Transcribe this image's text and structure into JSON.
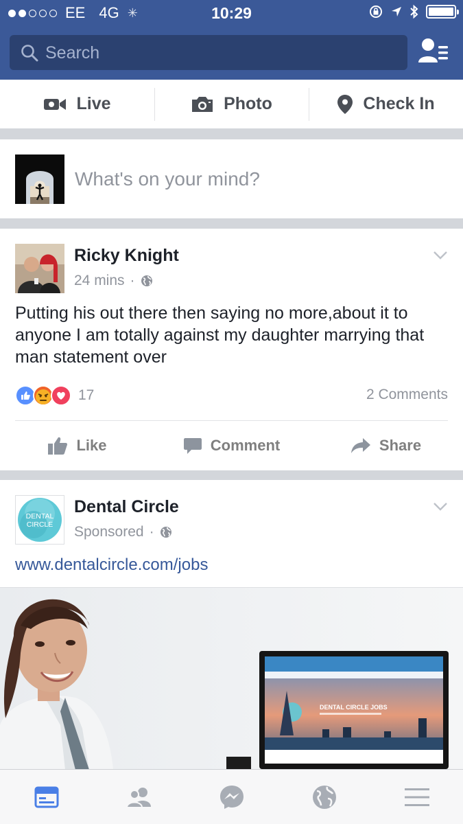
{
  "status_bar": {
    "carrier": "EE",
    "network": "4G",
    "time": "10:29"
  },
  "search": {
    "placeholder": "Search"
  },
  "composer": {
    "live_label": "Live",
    "photo_label": "Photo",
    "checkin_label": "Check In",
    "prompt": "What's on your mind?"
  },
  "post": {
    "author": "Ricky Knight",
    "time": "24 mins",
    "text": "Putting his out there then saying no more,about it to anyone I am totally against my daughter marrying that man statement over",
    "reaction_count": "17",
    "comments": "2 Comments",
    "like_label": "Like",
    "comment_label": "Comment",
    "share_label": "Share"
  },
  "ad": {
    "name": "Dental Circle",
    "sponsored": "Sponsored",
    "link": "www.dentalcircle.com/jobs",
    "logo_line1": "DENTAL",
    "logo_line2": "CIRCLE",
    "screen_title": "DENTAL CIRCLE JOBS"
  },
  "tabs": [
    {
      "icon": "news-feed-icon",
      "active": true
    },
    {
      "icon": "friend-requests-icon",
      "active": false
    },
    {
      "icon": "messenger-icon",
      "active": false
    },
    {
      "icon": "notifications-globe-icon",
      "active": false
    },
    {
      "icon": "menu-icon",
      "active": false
    }
  ],
  "colors": {
    "brand": "#3b5998",
    "link": "#365899",
    "like": "#5890ff",
    "angry": "#f7b125",
    "love": "#f0405d"
  }
}
